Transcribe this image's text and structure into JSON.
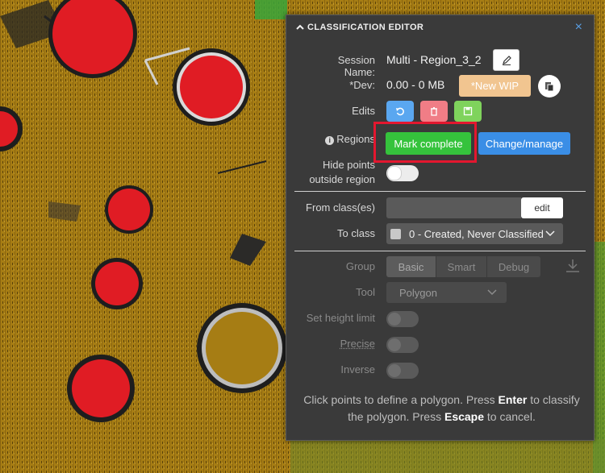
{
  "panel": {
    "title": "CLASSIFICATION EDITOR",
    "close_glyph": "×",
    "session_label": "Session Name:",
    "session_value": "Multi - Region_3_2",
    "dev_label": "*Dev:",
    "dev_value": "0.00 - 0 MB",
    "new_wip_label": "*New WIP",
    "edits_label": "Edits",
    "regions_label": "Regions",
    "mark_complete_label": "Mark complete",
    "change_manage_label": "Change/manage",
    "hide_points_label_1": "Hide points",
    "hide_points_label_2": "outside region",
    "from_class_label": "From class(es)",
    "edit_label": "edit",
    "to_class_label": "To class",
    "to_class_value": "0 - Created, Never Classified",
    "group_label": "Group",
    "group_options": [
      "Basic",
      "Smart",
      "Debug"
    ],
    "tool_label": "Tool",
    "tool_value": "Polygon",
    "height_limit_label": "Set height limit",
    "precise_label": "Precise",
    "inverse_label": "Inverse",
    "hint_1": "Click points to define a polygon. Press ",
    "hint_enter": "Enter",
    "hint_2": " to classify the polygon. Press ",
    "hint_escape": "Escape",
    "hint_3": " to cancel."
  },
  "colors": {
    "ground": "#a67d14",
    "marker_red": "#e01c24",
    "edit_blue": "#5aa7f0",
    "edit_pink": "#f07d86",
    "edit_green": "#7fd35c",
    "mark_complete_green": "#35c33c",
    "change_manage_blue": "#3a8ee6",
    "new_wip_peach": "#f1c590",
    "highlight_red": "#e3172f"
  },
  "icons": {
    "collapse": "chevron-up-icon",
    "pen": "pen-icon",
    "copy": "copy-icon",
    "undo": "undo-icon",
    "trash": "trash-icon",
    "save": "save-icon",
    "info": "info-icon",
    "dropdown": "chevron-down-icon",
    "download": "download-icon"
  }
}
